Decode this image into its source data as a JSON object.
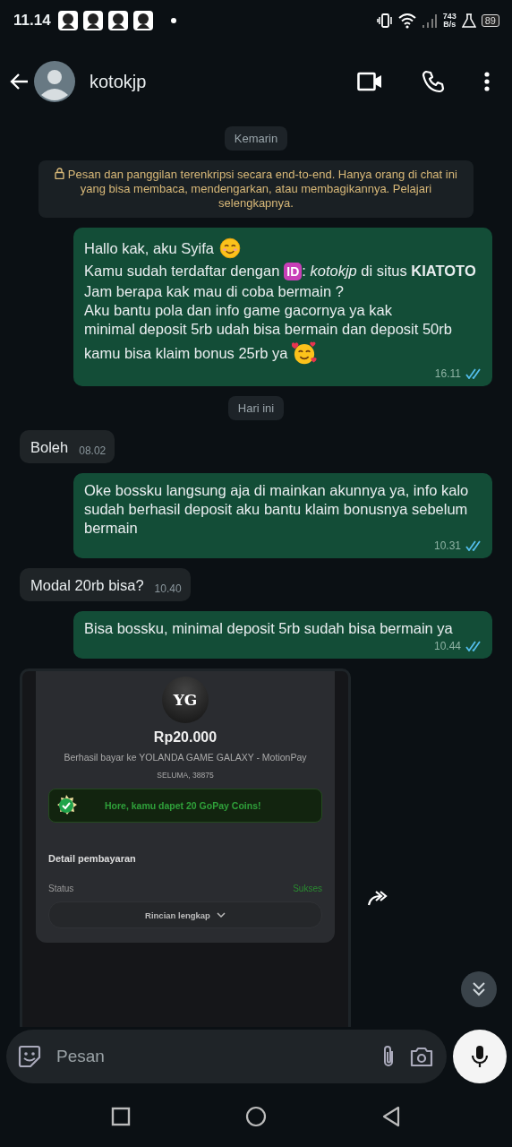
{
  "status_bar": {
    "time": "11.14",
    "speed_value": "743",
    "speed_unit": "B/s",
    "battery": "89"
  },
  "header": {
    "contact": "kotokjp"
  },
  "messages": [
    {
      "kind": "day",
      "text": "Kemarin"
    },
    {
      "kind": "notice",
      "text": "Pesan dan panggilan terenkripsi secara end-to-end. Hanya orang di chat ini yang bisa membaca, mendengarkan, atau membagikannya. Pelajari selengkapnya."
    },
    {
      "kind": "out",
      "time": "16.11",
      "read": true,
      "lines": [
        [
          {
            "kind": "text",
            "text": "Hallo kak, aku Syifa"
          },
          {
            "kind": "smile"
          }
        ],
        [
          {
            "kind": "text",
            "text": "Kamu sudah terdaftar dengan"
          },
          {
            "kind": "badge",
            "text": "ID"
          },
          {
            "kind": "text",
            "text": ": *kotokjp* di situs **KIATOTO**"
          }
        ],
        [
          {
            "kind": "text",
            "text": "Jam berapa kak mau di coba bermain ?\nAku bantu pola dan info game gacornya ya kak\nminimal deposit 5rb udah bisa bermain dan deposit 50rb"
          }
        ],
        [
          {
            "kind": "text",
            "text": "kamu bisa klaim bonus 25rb ya"
          },
          {
            "kind": "hearts"
          }
        ]
      ]
    },
    {
      "kind": "day",
      "text": "Hari ini"
    },
    {
      "kind": "in",
      "text": "Boleh",
      "time": "08.02"
    },
    {
      "kind": "out",
      "text": "Oke bossku langsung aja di mainkan akunnya ya, info kalo sudah berhasil deposit aku bantu klaim bonusnya sebelum bermain",
      "time": "10.31",
      "read": true
    },
    {
      "kind": "in",
      "text": "Modal 20rb bisa?",
      "time": "10.40"
    },
    {
      "kind": "out",
      "text": "Bisa bossku, minimal deposit 5rb sudah bisa bermain ya",
      "time": "10.44",
      "read": true
    },
    {
      "kind": "image",
      "receipt": {
        "initials": "YG",
        "amount": "Rp20.000",
        "merchant": "Berhasil bayar ke YOLANDA GAME GALAXY - MotionPay",
        "location": "SELUMA, 38875",
        "reward": "Hore, kamu dapet 20 GoPay Coins!",
        "section_title": "Detail pembayaran",
        "status_label": "Status",
        "status_value": "Sukses",
        "details_button": "Rincian lengkap"
      }
    }
  ],
  "composer": {
    "placeholder": "Pesan"
  }
}
